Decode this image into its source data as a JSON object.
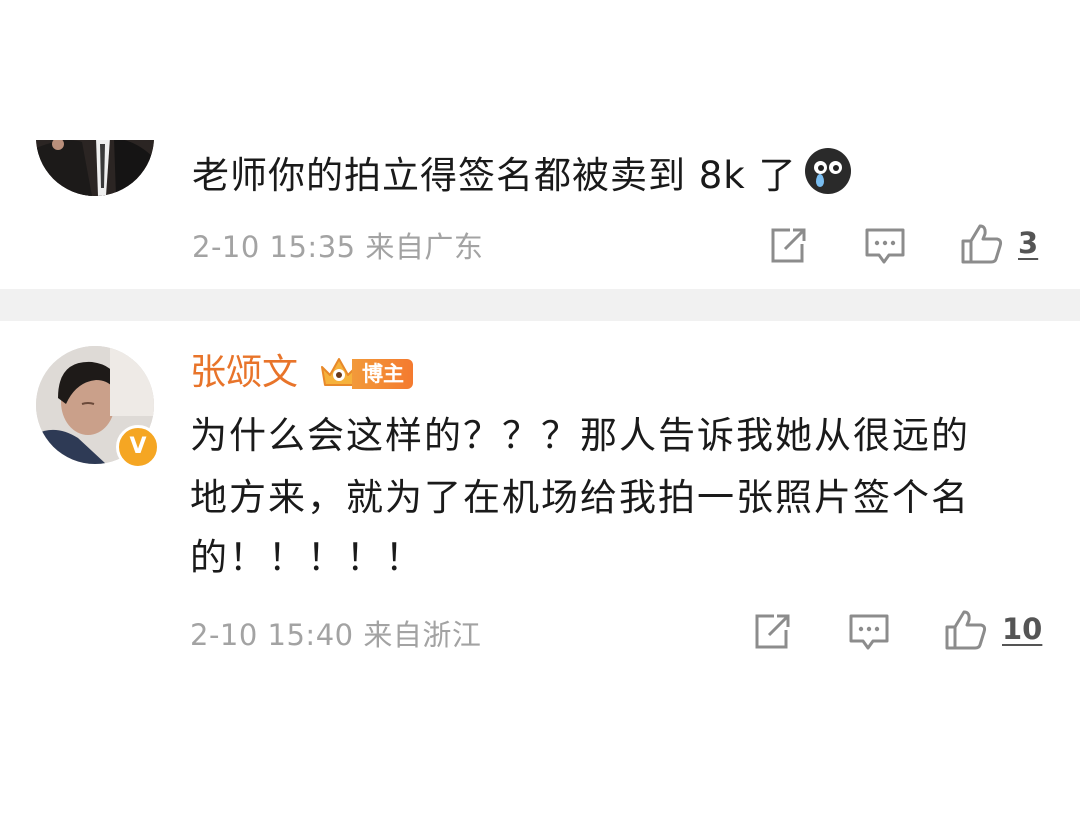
{
  "comments": [
    {
      "text": "老师你的拍立得签名都被卖到 8k 了",
      "emoji": "crying-face-icon",
      "time": "2-10 15:35",
      "location": "来自广东",
      "likes": "3"
    },
    {
      "author": "张颂文",
      "badge": "博主",
      "verified_mark": "V",
      "lines": [
        "为什么会这样的？？？那人告诉我她从很远的",
        "地方来，就为了在机场给我拍一张照片签个名",
        "的！！！！！"
      ],
      "time": "2-10 15:40",
      "location": "来自浙江",
      "likes": "10"
    }
  ],
  "colors": {
    "author_orange": "#e8742a",
    "meta_gray": "#a3a3a3",
    "divider": "#f1f1f1",
    "badge_gold": "#f5a623"
  }
}
